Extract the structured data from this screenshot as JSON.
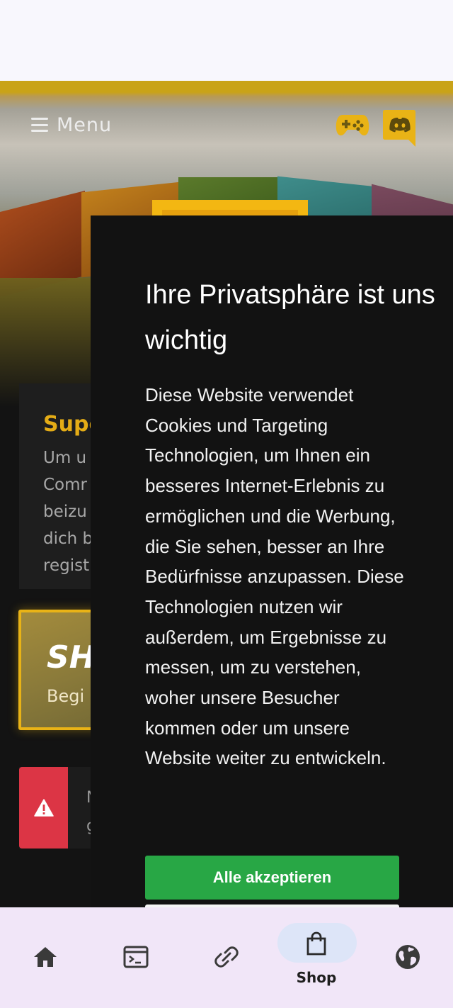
{
  "header": {
    "menu_label": "Menu",
    "gamepad_icon": "gamepad-icon",
    "discord_icon": "discord-icon"
  },
  "card": {
    "title": "Supe",
    "lines": [
      "Um u",
      "Comr",
      "beizu",
      "dich b",
      "regist"
    ]
  },
  "promo": {
    "title": "SH",
    "subtitle": "Begi"
  },
  "alert": {
    "icon": "warning-icon",
    "lines": [
      "N",
      "g"
    ]
  },
  "cookie_banner": {
    "title": "Ihre Privatsphäre ist uns wichtig",
    "text": "Diese Website verwendet Cookies und Targeting Technologien, um Ihnen ein besseres Internet-Erlebnis zu ermöglichen und die Werbung, die Sie sehen, besser an Ihre Bedürfnisse anzupassen. Diese Technologien nutzen wir außerdem, um Ergebnisse zu messen, um zu verstehen, woher unsere Besucher kommen oder um unsere Website weiter zu entwickeln.",
    "accept_label": "Alle akzeptieren"
  },
  "bottom_nav": {
    "items": [
      {
        "icon": "home-icon",
        "label": ""
      },
      {
        "icon": "terminal-window-icon",
        "label": ""
      },
      {
        "icon": "link-icon",
        "label": ""
      },
      {
        "icon": "shopping-bag-icon",
        "label": "Shop",
        "active": true
      },
      {
        "icon": "globe-icon",
        "label": ""
      }
    ]
  },
  "colors": {
    "accent_gold": "#e4ac16",
    "accept_green": "#28a745",
    "alert_red": "#dc3545",
    "nav_bg": "#f1e6f8",
    "nav_active_pill": "#dde5f8"
  }
}
